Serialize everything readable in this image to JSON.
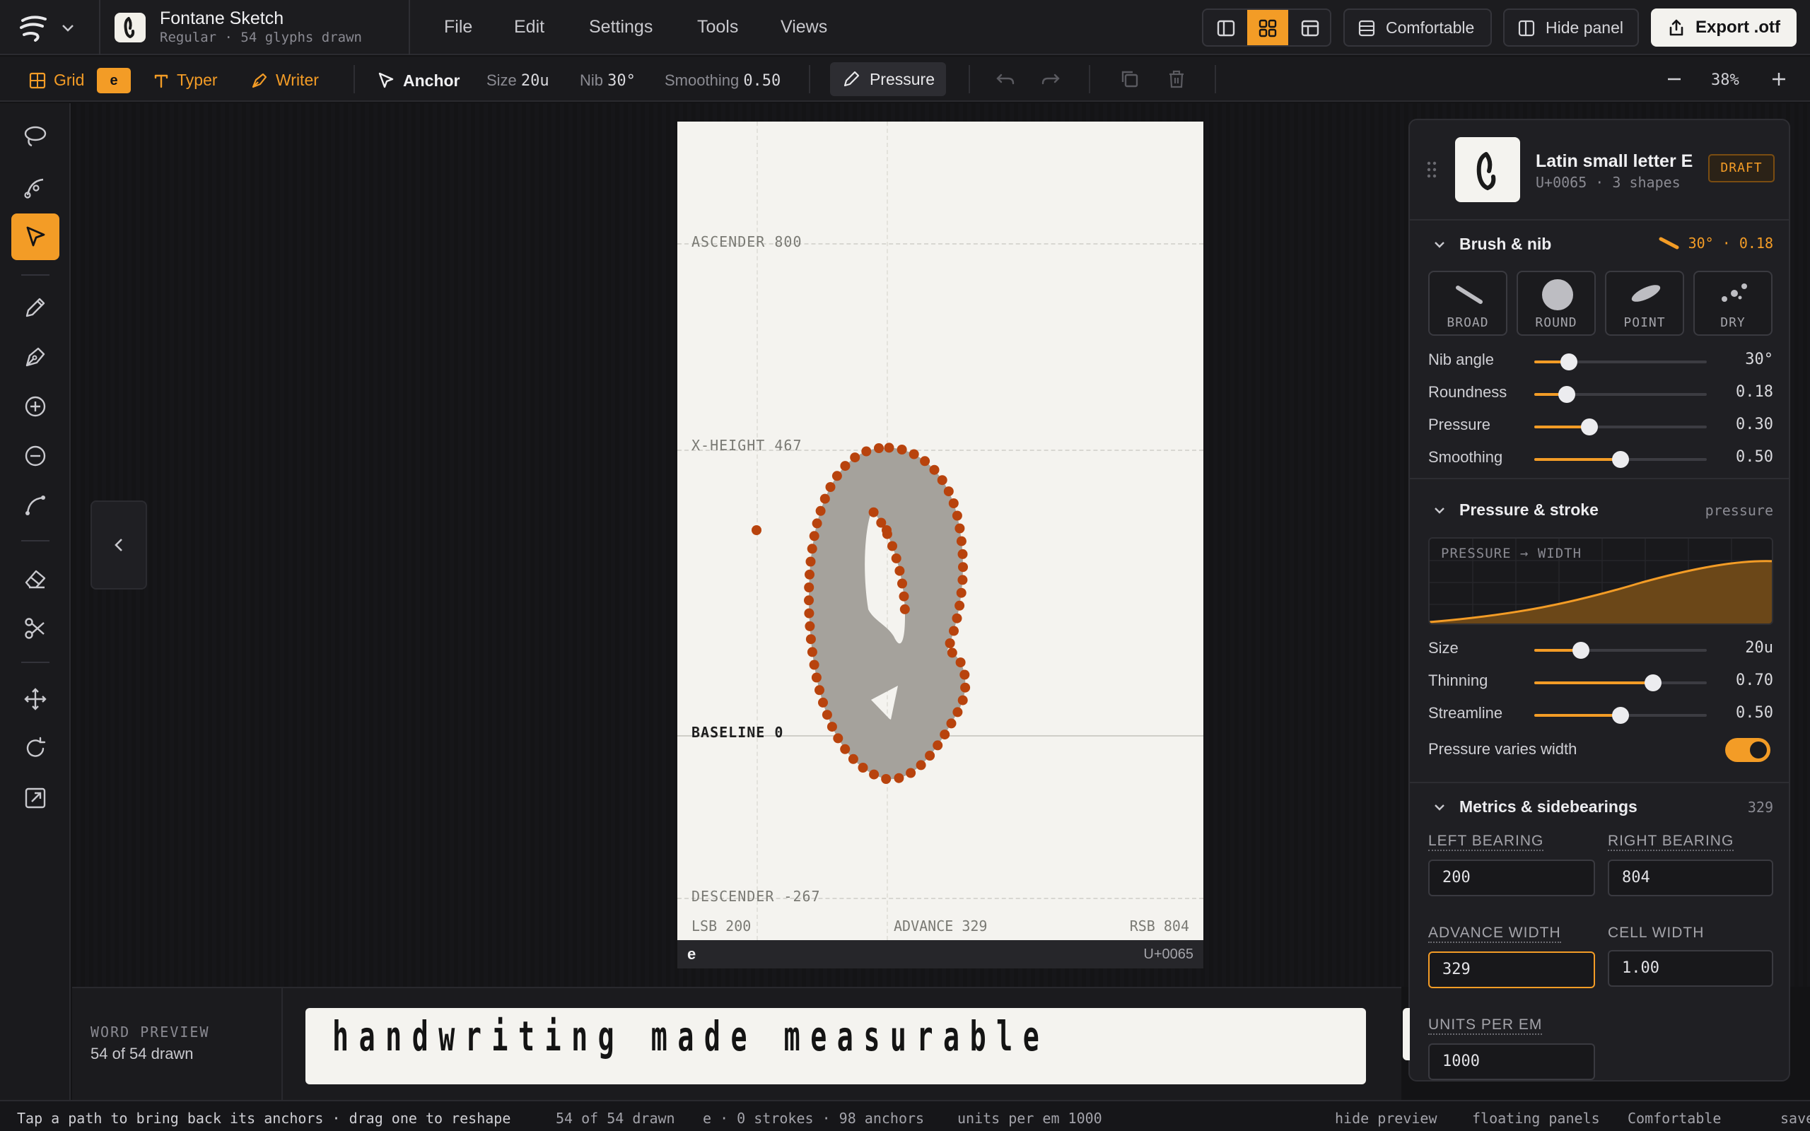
{
  "app": {
    "project_title": "Fontane Sketch",
    "project_subtitle": "Regular · 54 glyphs drawn"
  },
  "menu": [
    "File",
    "Edit",
    "Settings",
    "Tools",
    "Views"
  ],
  "header": {
    "density": "Comfortable",
    "hide_panel": "Hide panel",
    "export": "Export .otf"
  },
  "toolbar": {
    "grid": "Grid",
    "glyph": "e",
    "typer": "Typer",
    "writer": "Writer",
    "anchor": "Anchor",
    "size_label": "Size",
    "size_value": "20u",
    "nib_label": "Nib",
    "nib_value": "30°",
    "smoothing_label": "Smoothing",
    "smoothing_value": "0.50",
    "pressure": "Pressure",
    "zoom": "38%"
  },
  "canvas": {
    "ascender": "ASCENDER 800",
    "xheight": "X-HEIGHT 467",
    "baseline": "BASELINE 0",
    "descender": "DESCENDER -267",
    "lsb": "LSB 200",
    "advance": "ADVANCE 329",
    "rsb": "RSB 804",
    "glyph": "e",
    "codepoint": "U+0065"
  },
  "preview": {
    "label": "WORD PREVIEW",
    "count": "54 of 54 drawn",
    "text": "handwriting made measurable"
  },
  "panel": {
    "title": "Latin small letter E",
    "subtitle": "U+0065 · 3 shapes",
    "badge": "DRAFT",
    "brush": {
      "title": "Brush & nib",
      "summary": "30° · 0.18",
      "nibs": [
        "BROAD",
        "ROUND",
        "POINT",
        "DRY"
      ],
      "sliders": [
        {
          "label": "Nib angle",
          "value": "30°",
          "level": 0.2
        },
        {
          "label": "Roundness",
          "value": "0.18",
          "level": 0.19
        },
        {
          "label": "Pressure",
          "value": "0.30",
          "level": 0.32
        },
        {
          "label": "Smoothing",
          "value": "0.50",
          "level": 0.5
        }
      ]
    },
    "pressure": {
      "title": "Pressure & stroke",
      "tag": "pressure",
      "curve_label": "PRESSURE → WIDTH",
      "sliders": [
        {
          "label": "Size",
          "value": "20u",
          "level": 0.27
        },
        {
          "label": "Thinning",
          "value": "0.70",
          "level": 0.69
        },
        {
          "label": "Streamline",
          "value": "0.50",
          "level": 0.5
        }
      ],
      "toggle_label": "Pressure varies width",
      "toggle_on": true
    },
    "metrics": {
      "title": "Metrics & sidebearings",
      "value": "329",
      "left_label": "LEFT BEARING",
      "left": "200",
      "right_label": "RIGHT BEARING",
      "right": "804",
      "advance_label": "ADVANCE WIDTH",
      "advance": "329",
      "cell_label": "CELL WIDTH",
      "cell": "1.00",
      "upm_label": "UNITS PER EM",
      "upm": "1000"
    }
  },
  "status": {
    "hint": "Tap a path to bring back its anchors · drag one to reshape",
    "drawn": "54 of 54 drawn",
    "info": "e · 0 strokes · 98 anchors",
    "upm": "units per em 1000",
    "hide_preview": "hide preview",
    "floating": "floating panels",
    "density": "Comfortable",
    "saved": "saved"
  },
  "colors": {
    "accent": "#f39c26",
    "anchor": "#b8430d",
    "glyph_fill": "#a5a29c",
    "paper": "#f4f3ef"
  }
}
